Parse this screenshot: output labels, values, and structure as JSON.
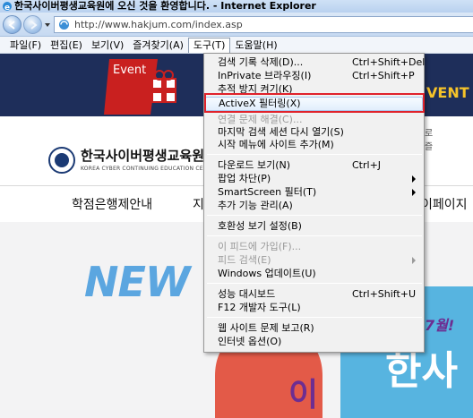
{
  "window": {
    "title": "한국사이버평생교육원에 오신 것을 환영합니다. - Internet Explorer",
    "url": "http://www.hakjum.com/index.asp"
  },
  "menubar": {
    "items": [
      {
        "label": "파일(F)"
      },
      {
        "label": "편집(E)"
      },
      {
        "label": "보기(V)"
      },
      {
        "label": "즐겨찾기(A)"
      },
      {
        "label": "도구(T)",
        "active": true
      },
      {
        "label": "도움말(H)"
      }
    ]
  },
  "tools_menu": {
    "items": [
      {
        "label": "검색 기록 삭제(D)...",
        "shortcut": "Ctrl+Shift+Del"
      },
      {
        "label": "InPrivate 브라우징(I)",
        "shortcut": "Ctrl+Shift+P"
      },
      {
        "label": "추적 방지 켜기(K)",
        "shortcut": ""
      },
      {
        "label": "ActiveX 필터링(X)",
        "shortcut": "",
        "highlighted": true
      },
      {
        "label": "연결 문제 해결(C)...",
        "shortcut": "",
        "disabled": true
      },
      {
        "label": "마지막 검색 세션 다시 열기(S)",
        "shortcut": ""
      },
      {
        "label": "시작 메뉴에 사이트 추가(M)",
        "shortcut": ""
      },
      {
        "label": "다운로드 보기(N)",
        "shortcut": "Ctrl+J"
      },
      {
        "label": "팝업 차단(P)",
        "shortcut": "",
        "submenu": true
      },
      {
        "label": "SmartScreen 필터(T)",
        "shortcut": "",
        "submenu": true
      },
      {
        "label": "추가 기능 관리(A)",
        "shortcut": ""
      },
      {
        "label": "호환성 보기 설정(B)",
        "shortcut": ""
      },
      {
        "label": "이 피드에 가입(F)...",
        "shortcut": "",
        "disabled": true
      },
      {
        "label": "피드 검색(E)",
        "shortcut": "",
        "disabled": true,
        "submenu": true
      },
      {
        "label": "Windows 업데이트(U)",
        "shortcut": ""
      },
      {
        "label": "성능 대시보드",
        "shortcut": "Ctrl+Shift+U"
      },
      {
        "label": "F12 개발자 도구(L)",
        "shortcut": ""
      },
      {
        "label": "웹 사이트 문제 보고(R)",
        "shortcut": ""
      },
      {
        "label": "인터넷 옵션(O)",
        "shortcut": ""
      }
    ]
  },
  "site": {
    "event_badge": "Event",
    "event_right": "VENT",
    "links": [
      "로",
      "즐"
    ],
    "logo_name": "한국사이버평생교육원",
    "logo_sub": "KOREA CYBER CONTINUING EDUCATION CENTER",
    "nav": [
      "학점은행제안내",
      "지",
      "이페이지"
    ],
    "banner_new": "NEW",
    "banner_month": "7월!",
    "banner_han": "한사",
    "banner_bo": "이"
  },
  "colors": {
    "header_band": "#1e2e5a",
    "highlight_box": "#e0222b",
    "new_text": "#5ba6e0",
    "banner_blue": "#57b4e0",
    "banner_purple": "#6d2d91"
  }
}
